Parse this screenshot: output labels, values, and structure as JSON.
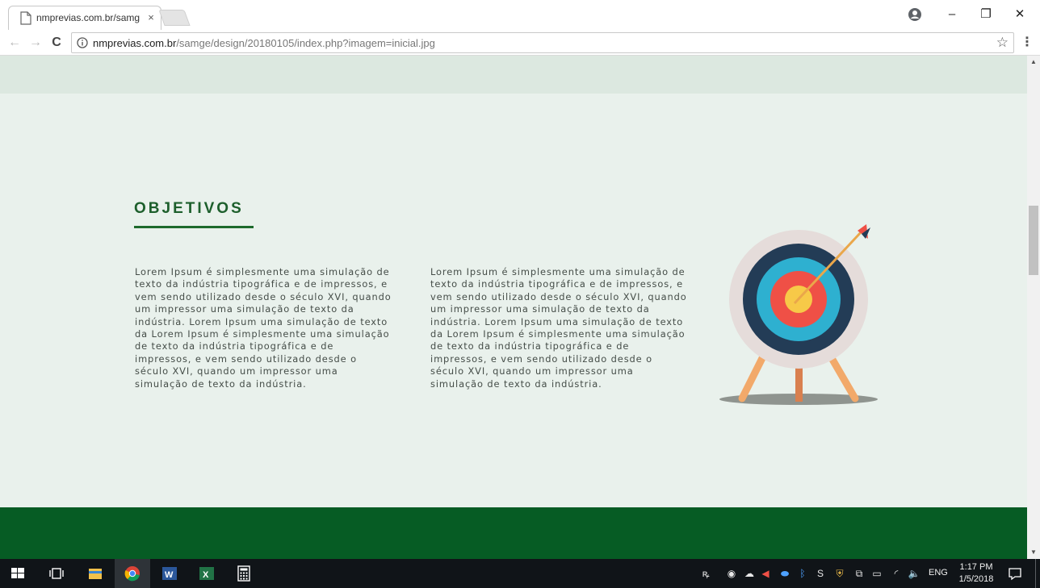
{
  "browser": {
    "tab_title": "nmprevias.com.br/samge",
    "tab_close": "×",
    "url_host": "nmprevias.com.br",
    "url_path": "/samge/design/20180105/index.php?imagem=inicial.jpg",
    "back_glyph": "←",
    "forward_glyph": "→",
    "reload_glyph": "C",
    "star_glyph": "☆",
    "menu_glyph": "⋮",
    "minimize_glyph": "–",
    "restore_glyph": "❐",
    "close_glyph": "✕"
  },
  "page": {
    "heading": "OBJETIVOS",
    "column_1": "Lorem Ipsum é simplesmente uma simulação de texto da indústria tipográfica e de impressos, e vem sendo utilizado desde o século XVI, quando um impressor uma simulação de texto da indústria. Lorem Ipsum uma simulação de texto da Lorem Ipsum é simplesmente uma simulação de texto da indústria tipográfica e de impressos, e vem sendo utilizado desde o século XVI, quando um impressor uma simulação de texto da indústria.",
    "column_2": "Lorem Ipsum é simplesmente uma simulação de texto da indústria tipográfica e de impressos, e vem sendo utilizado desde o século XVI, quando um impressor uma simulação de texto da indústria. Lorem Ipsum uma simulação de texto da Lorem Ipsum é simplesmente uma simulação de texto da indústria tipográfica e de impressos, e vem sendo utilizado desde o século XVI, quando um impressor uma simulação de texto da indústria."
  },
  "taskbar": {
    "language": "ENG",
    "time": "1:17 PM",
    "date": "1/5/2018",
    "apps": [
      "start",
      "task-view",
      "file-explorer",
      "chrome",
      "word",
      "excel",
      "calculator"
    ]
  },
  "colors": {
    "accent_green": "#1d5f2c",
    "footer_green": "#065c24",
    "section_bg": "#e9f1ec",
    "top_band": "#dce8e0"
  }
}
